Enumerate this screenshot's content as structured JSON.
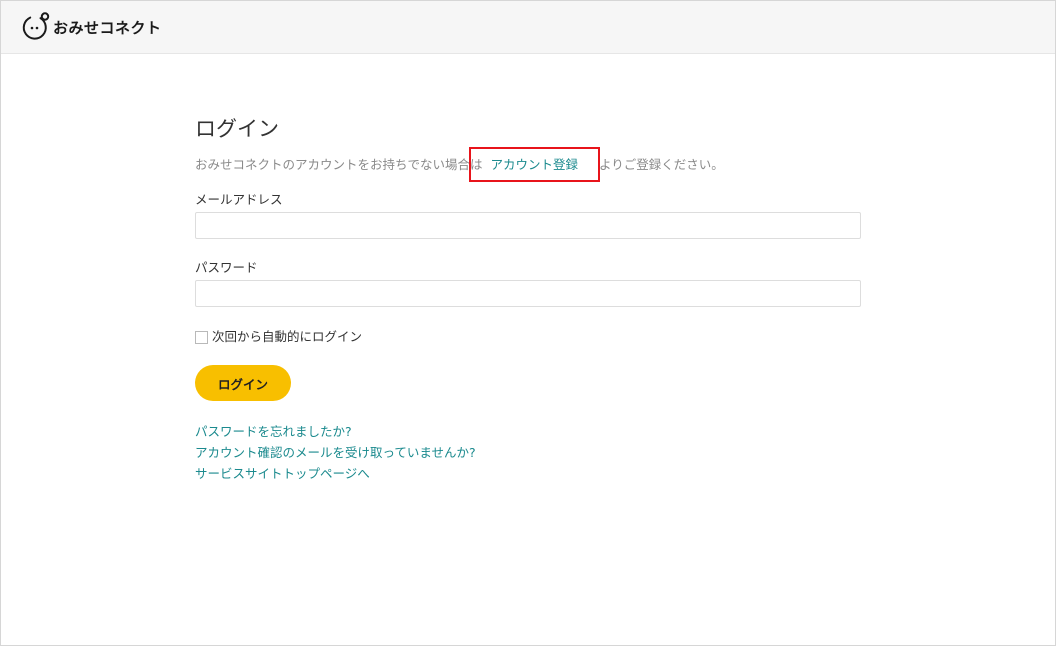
{
  "header": {
    "brand_name": "おみせコネクト",
    "logo_icon": "smiley-face-icon"
  },
  "login": {
    "title": "ログイン",
    "lead_before": "おみせコネクトのアカウントをお持ちでない場合は",
    "register_link": "アカウント登録",
    "lead_after": "よりご登録ください。",
    "email_label": "メールアドレス",
    "email_value": "",
    "password_label": "パスワード",
    "password_value": "",
    "remember_label": "次回から自動的にログイン",
    "remember_checked": false,
    "submit_label": "ログイン"
  },
  "links": [
    "パスワードを忘れましたか?",
    "アカウント確認のメールを受け取っていませんか?",
    "サービスサイトトップページへ"
  ],
  "colors": {
    "accent_button": "#f8bf00",
    "link": "#1b8a8e",
    "highlight_border": "#e8141b",
    "header_bg": "#f6f6f6"
  }
}
